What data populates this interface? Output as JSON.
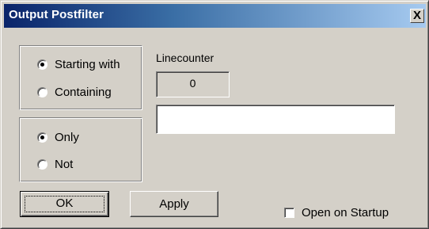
{
  "window": {
    "title": "Output Postfilter",
    "close_label": "X"
  },
  "match_mode": {
    "options": [
      {
        "label": "Starting with",
        "checked": true
      },
      {
        "label": "Containing",
        "checked": false
      }
    ]
  },
  "inclusion": {
    "options": [
      {
        "label": "Only",
        "checked": true
      },
      {
        "label": "Not",
        "checked": false
      }
    ]
  },
  "linecounter": {
    "label": "Linecounter",
    "value": "0"
  },
  "filter_text": {
    "value": "",
    "placeholder": ""
  },
  "buttons": {
    "ok": "OK",
    "apply": "Apply"
  },
  "startup": {
    "label": "Open on Startup",
    "checked": false
  }
}
